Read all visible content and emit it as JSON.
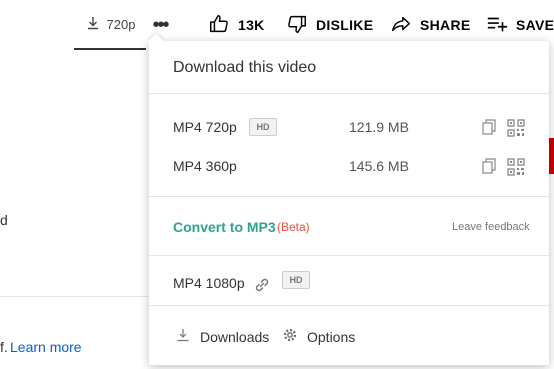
{
  "topbar": {
    "download_quality": "720p",
    "more_label": "•••",
    "like_count": "13K",
    "dislike_label": "DISLIKE",
    "share_label": "SHARE",
    "save_label": "SAVE"
  },
  "page": {
    "left_fragment_d": "d",
    "left_fragment_f": "f.",
    "learn_more": "Learn more"
  },
  "popup": {
    "title": "Download this video",
    "formats": [
      {
        "name": "MP4 720p",
        "badge": "HD",
        "size": "121.9 MB"
      },
      {
        "name": "MP4 360p",
        "badge": "",
        "size": "145.6 MB"
      }
    ],
    "convert_label": "Convert to MP3",
    "beta_label": "(Beta)",
    "feedback_label": "Leave feedback",
    "extra_format": {
      "name": "MP4 1080p",
      "badge": "HD"
    },
    "footer": {
      "downloads_label": "Downloads",
      "options_label": "Options"
    }
  },
  "colors": {
    "convert": "#2ca58d",
    "beta": "#e5533d",
    "link": "#065fd4",
    "accent_red": "#cc0000"
  },
  "icons": [
    "download-icon",
    "like-icon",
    "dislike-icon",
    "share-icon",
    "save-icon",
    "copy-icon",
    "qr-icon",
    "link-icon",
    "gear-icon"
  ]
}
